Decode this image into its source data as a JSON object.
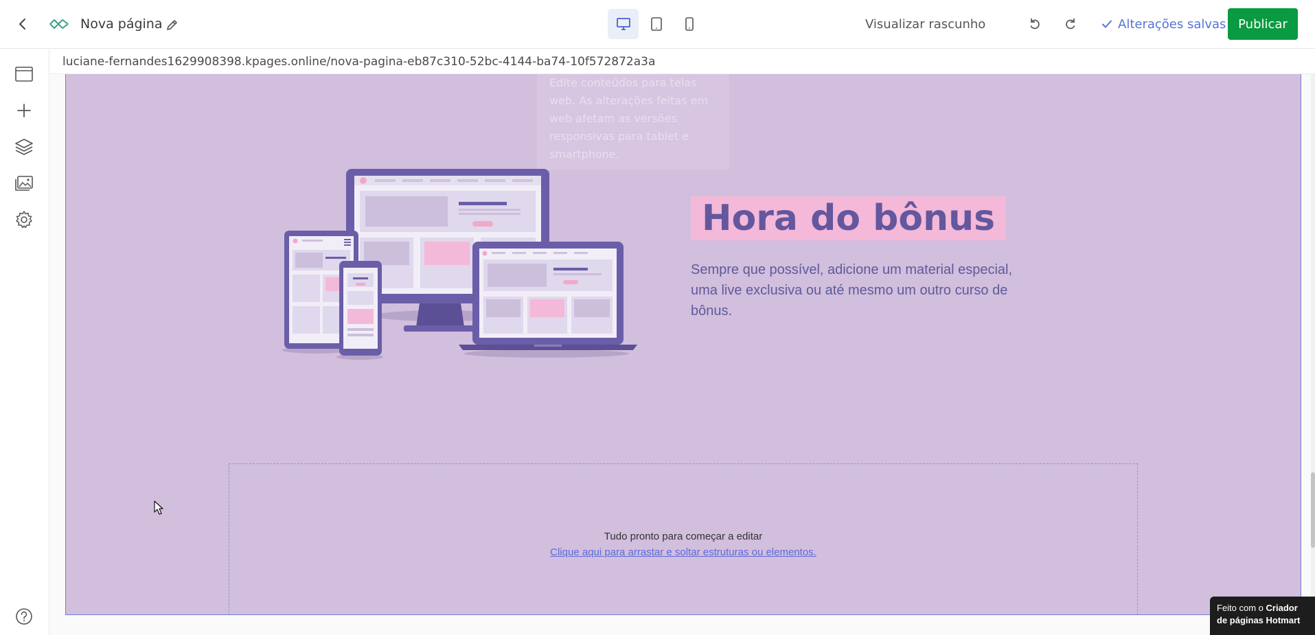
{
  "header": {
    "page_name": "Nova página",
    "preview_label": "Visualizar rascunho",
    "saved_label": "Alterações salvas",
    "publish_label": "Publicar",
    "accent_color": "#5474d6",
    "publish_color": "#0a9a41",
    "active_device": "desktop"
  },
  "url": "luciane-fernandes1629908398.kpages.online/nova-pagina-eb87c310-52bc-4144-ba74-10f572872a3a",
  "section": {
    "background_color": "#d2bedd",
    "ghost_tooltip": "Edite conteúdos para telas web. As alterações feitas em web afetam as versões responsivas para tablet e smartphone.",
    "headline": "Hora do bônus",
    "headline_bg": "#f4b8d8",
    "headline_color": "#63579e",
    "subtext": "Sempre que possível, adicione um material especial, uma live exclusiva ou até mesmo um outro curso de bônus."
  },
  "dropzone": {
    "title": "Tudo pronto para começar a editar",
    "link": "Clique aqui para arrastar e soltar estruturas ou elementos."
  },
  "badge": {
    "prefix": "Feito com o ",
    "brand": "Criador de páginas Hotmart"
  },
  "sidebar_icons": [
    "page-icon",
    "plus-icon",
    "layers-icon",
    "image-icon",
    "gear-icon",
    "help-icon"
  ]
}
